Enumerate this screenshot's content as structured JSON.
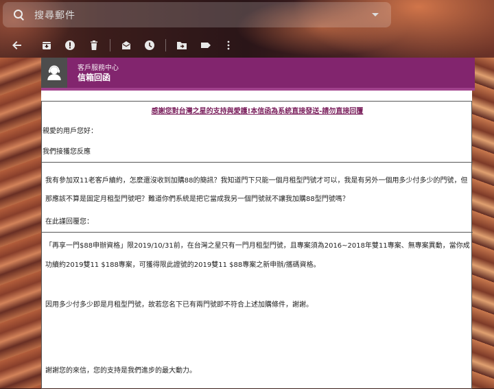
{
  "search": {
    "placeholder": "搜尋郵件"
  },
  "toolbar": {
    "icons": [
      "back-icon",
      "archive-icon",
      "report-spam-icon",
      "delete-icon",
      "mark-unread-icon",
      "snooze-icon",
      "move-to-icon",
      "label-icon",
      "more-icon"
    ]
  },
  "mail_header": {
    "subtitle": "客戶服務中心",
    "title": "信箱回函"
  },
  "email": {
    "notice": "感謝您對台灣之星的支持與愛護!本信函為系統直接發送-請勿直接回覆",
    "greeting": "親愛的用戶您好：",
    "received": "我們接獲您反應",
    "question": "我有參加双11老客戶續約，怎麼還沒收到加購88的簡訊？我知道門下只能一個月租型門號才可以，我是有另外一個用多少付多少的門號，但那應該不算是固定月租型門號吧？難道你們系統是把它當成我另一個門號就不讓我加購88型門號嗎？",
    "reply_label": "在此謹回覆您：",
    "answer_1": "「再享一門$88申辦資格」限2019/10/31前，在台灣之星只有一門月租型門號，且專案須為2016~2018年雙11專案、無專案異動，當你成功續約2019雙11 $188專案，可獲得限此證號的2019雙11 $88專案之新申辦/攜碼資格。",
    "answer_2": "因用多少付多少即是月租型門號，故若您名下已有兩門號即不符合上述加購條件，謝謝。",
    "closing": "謝謝您的來信，您的支持是我們進步的最大動力。"
  },
  "colors": {
    "header_purple": "#82256e",
    "notice_link": "#7a1f5c"
  }
}
